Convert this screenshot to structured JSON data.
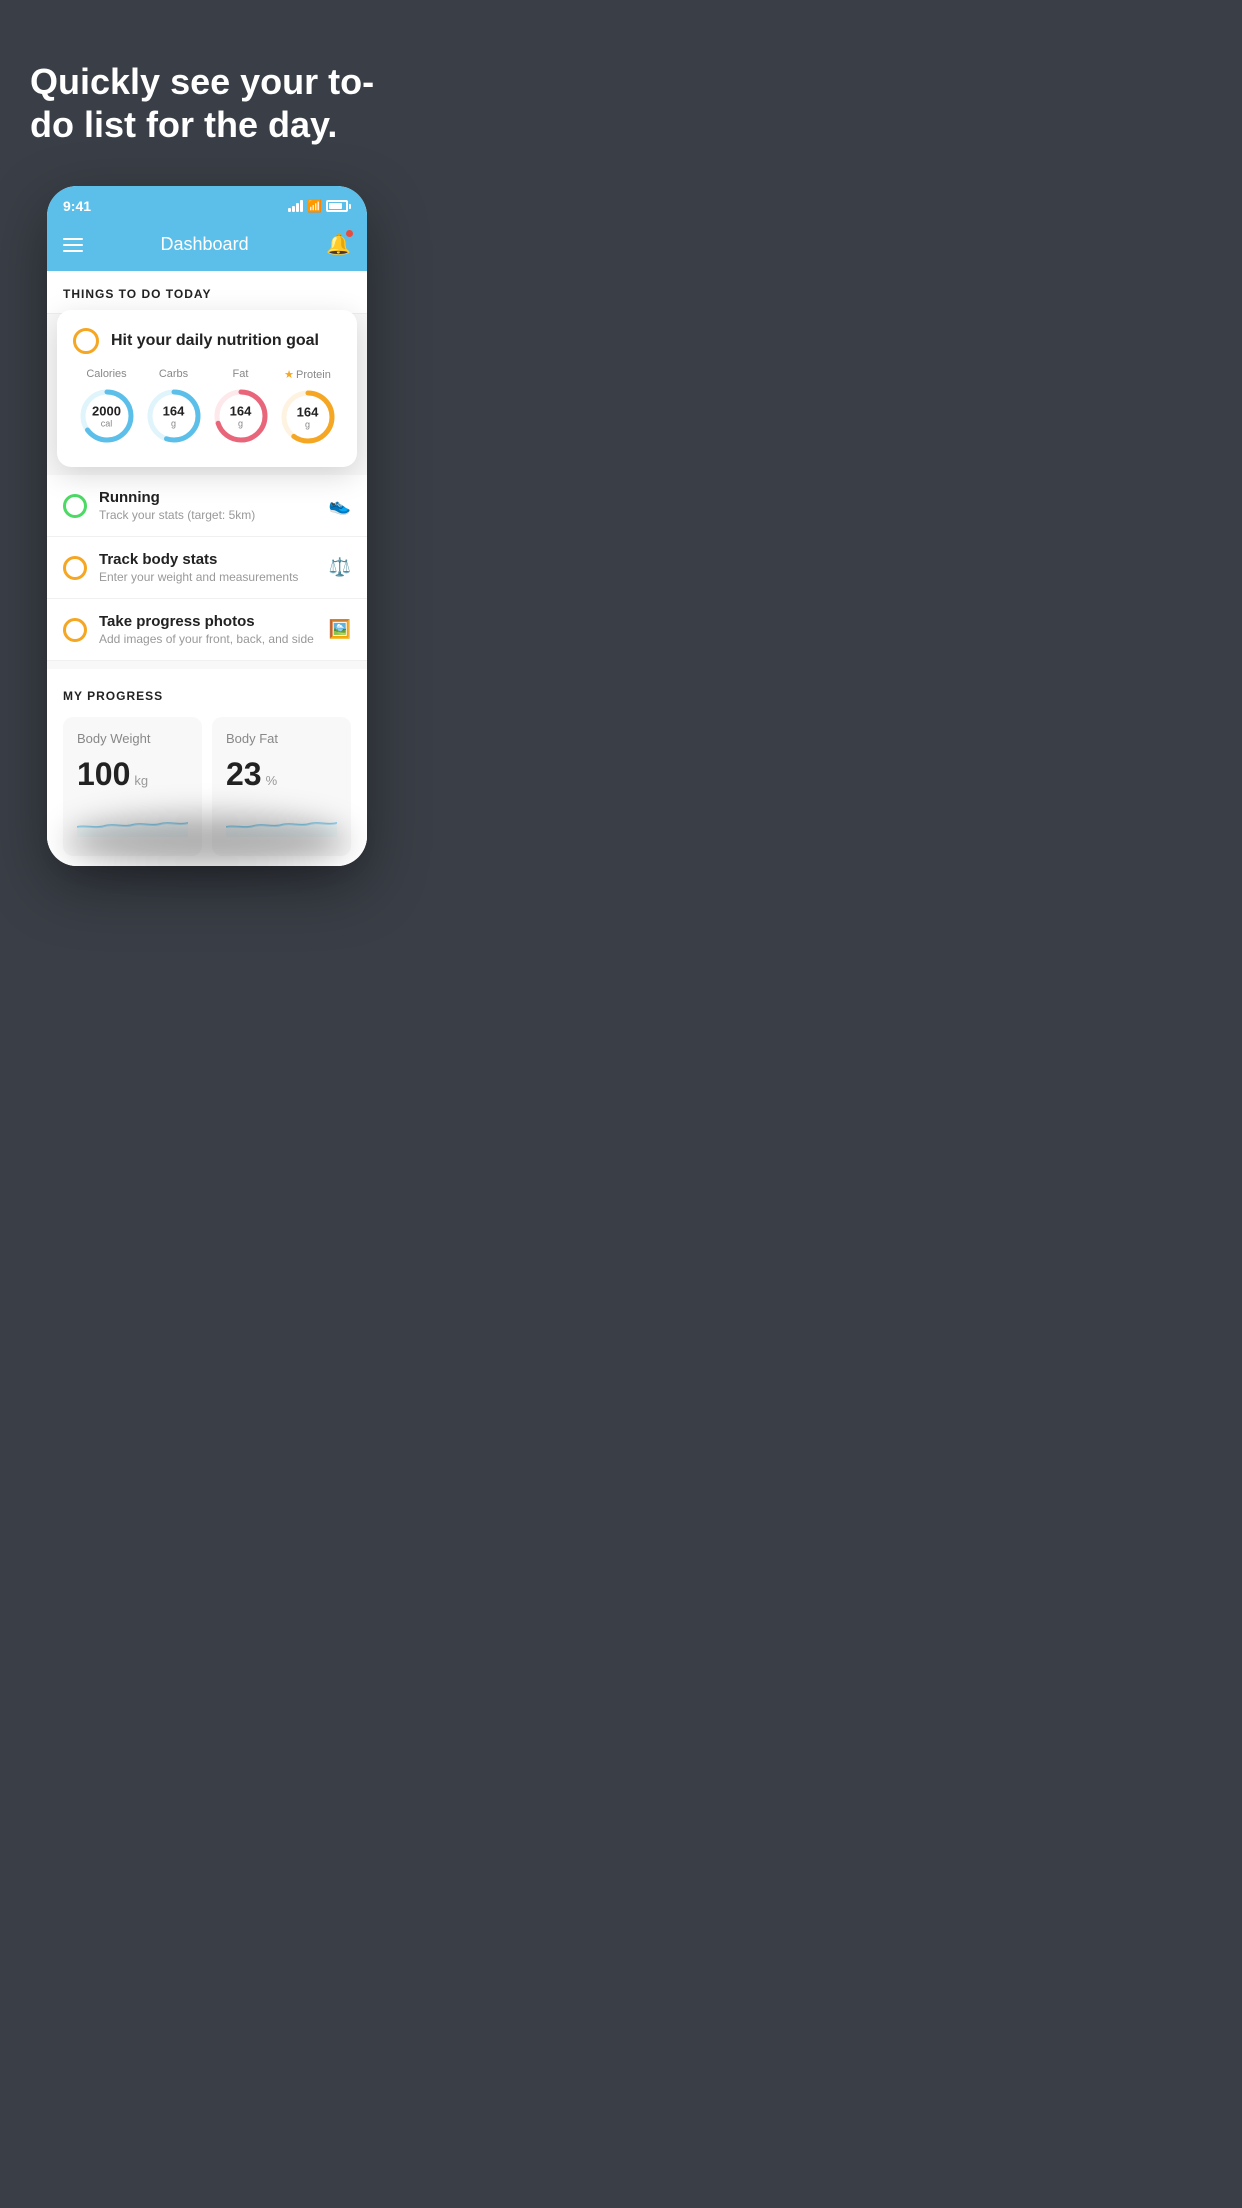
{
  "hero": {
    "title": "Quickly see your to-do list for the day."
  },
  "status_bar": {
    "time": "9:41"
  },
  "nav": {
    "title": "Dashboard"
  },
  "things_section": {
    "title": "THINGS TO DO TODAY"
  },
  "nutrition_card": {
    "title": "Hit your daily nutrition goal",
    "items": [
      {
        "label": "Calories",
        "value": "2000",
        "unit": "cal",
        "color": "#5bbfea",
        "trail": "#e0f4fb",
        "pct": 65,
        "starred": false
      },
      {
        "label": "Carbs",
        "value": "164",
        "unit": "g",
        "color": "#5bbfea",
        "trail": "#e0f4fb",
        "pct": 55,
        "starred": false
      },
      {
        "label": "Fat",
        "value": "164",
        "unit": "g",
        "color": "#e8657a",
        "trail": "#fde8ec",
        "pct": 70,
        "starred": false
      },
      {
        "label": "Protein",
        "value": "164",
        "unit": "g",
        "color": "#f5a623",
        "trail": "#fef3e0",
        "pct": 60,
        "starred": true
      }
    ]
  },
  "todo_items": [
    {
      "id": "running",
      "title": "Running",
      "subtitle": "Track your stats (target: 5km)",
      "checked": true,
      "icon": "👟"
    },
    {
      "id": "body-stats",
      "title": "Track body stats",
      "subtitle": "Enter your weight and measurements",
      "checked": false,
      "icon": "⚖️"
    },
    {
      "id": "progress-photos",
      "title": "Take progress photos",
      "subtitle": "Add images of your front, back, and side",
      "checked": false,
      "icon": "🖼️"
    }
  ],
  "progress_section": {
    "title": "MY PROGRESS",
    "cards": [
      {
        "id": "body-weight",
        "title": "Body Weight",
        "value": "100",
        "unit": "kg"
      },
      {
        "id": "body-fat",
        "title": "Body Fat",
        "value": "23",
        "unit": "%"
      }
    ]
  }
}
